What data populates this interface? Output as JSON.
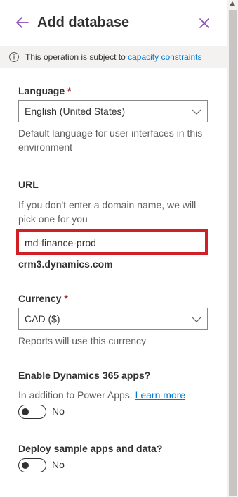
{
  "header": {
    "title": "Add database",
    "back_icon": "back-arrow-icon",
    "close_icon": "close-icon"
  },
  "notice": {
    "text": "This operation is subject to",
    "link": "capacity constraints",
    "icon": "info-icon"
  },
  "language": {
    "label": "Language",
    "required": "*",
    "value": "English (United States)",
    "help": "Default language for user interfaces in this environment"
  },
  "url": {
    "label": "URL",
    "help": "If you don't enter a domain name, we will pick one for you",
    "value": "md-finance-prod",
    "domain_suffix": "crm3.dynamics.com"
  },
  "currency": {
    "label": "Currency",
    "required": "*",
    "value": "CAD ($)",
    "help": "Reports will use this currency"
  },
  "dynamics": {
    "label": "Enable Dynamics 365 apps?",
    "help": "In addition to Power Apps.",
    "learn_more": "Learn more",
    "toggle_state": "No"
  },
  "sample": {
    "label": "Deploy sample apps and data?",
    "toggle_state": "No"
  },
  "colors": {
    "accent": "#0078d4",
    "close": "#8a4fb8",
    "highlight": "#d21f26",
    "required": "#a4262c"
  }
}
